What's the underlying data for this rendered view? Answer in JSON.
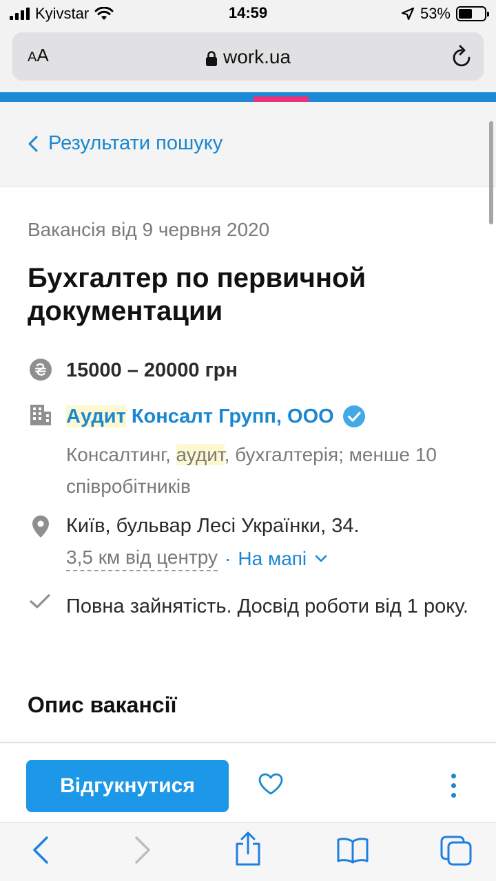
{
  "status_bar": {
    "carrier": "Kyivstar",
    "time": "14:59",
    "battery": "53%",
    "battery_level": 0.53
  },
  "browser": {
    "text_size_label_small": "A",
    "text_size_label_large": "A",
    "domain": "work.ua"
  },
  "nav": {
    "back_label": "Результати пошуку"
  },
  "vacancy": {
    "date": "Вакансія від 9 червня 2020",
    "title": "Бухгалтер по первичной документации",
    "salary": "15000 – 20000 грн",
    "company": {
      "name_highlight": "Аудит",
      "name_rest": " Консалт Групп, ООО",
      "verified": true,
      "desc_part1": "Консалтинг, ",
      "desc_highlight": "аудит",
      "desc_part2": ", бухгалтерія; менше 10 співробітників"
    },
    "address": "Київ, бульвар Лесі Українки, 34.",
    "distance": "3,5 км від центру",
    "separator": "·",
    "map_link": "На мапі",
    "employment": "Повна зайнятість. Досвід роботи від 1 року.",
    "description_heading": "Опис вакансії"
  },
  "actions": {
    "apply_label": "Відгукнутися"
  },
  "colors": {
    "link": "#1a87d0",
    "primary_button": "#1d97e8",
    "accent_bar": "#1e8ad6",
    "accent_mark": "#e8337c",
    "highlight": "#fcf8cf"
  },
  "icons": {
    "status": [
      "signal-icon",
      "wifi-icon",
      "location-arrow-icon",
      "battery-icon"
    ],
    "address_bar": [
      "text-size-icon",
      "lock-icon",
      "reload-icon"
    ],
    "vacancy": [
      "hryvnia-icon",
      "building-icon",
      "verified-icon",
      "location-pin-icon",
      "checkmark-icon",
      "chevron-down-icon"
    ],
    "actions": [
      "heart-icon",
      "more-vertical-icon"
    ],
    "toolbar": [
      "back-arrow-icon",
      "forward-arrow-icon",
      "share-icon",
      "bookmarks-icon",
      "tabs-icon"
    ]
  }
}
